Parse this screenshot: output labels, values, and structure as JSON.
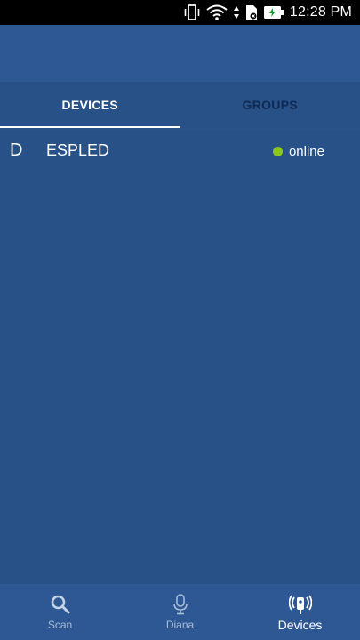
{
  "status_bar": {
    "time": "12:28 PM",
    "icons": [
      "vibrate-icon",
      "wifi-icon",
      "sim-card-icon",
      "battery-charging-icon"
    ]
  },
  "tabs": [
    {
      "label": "DEVICES",
      "active": true
    },
    {
      "label": "GROUPS",
      "active": false
    }
  ],
  "devices": [
    {
      "initial": "D",
      "name": "ESPLED",
      "status": "online",
      "status_color": "#8bc61d"
    }
  ],
  "bottom_nav": [
    {
      "label": "Scan",
      "icon": "search-icon",
      "active": false
    },
    {
      "label": "Diana",
      "icon": "microphone-icon",
      "active": false
    },
    {
      "label": "Devices",
      "icon": "broadcast-device-icon",
      "active": true
    }
  ],
  "colors": {
    "background": "#285187",
    "app_bar": "#2d5894",
    "inactive_tab": "#0f2a52",
    "online": "#8bc61d"
  }
}
